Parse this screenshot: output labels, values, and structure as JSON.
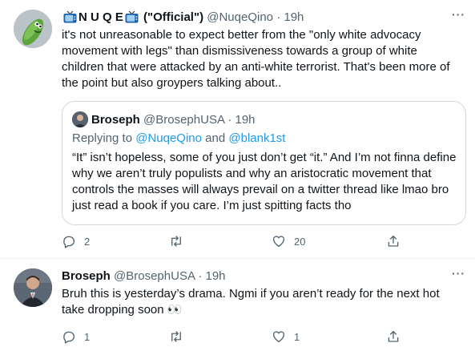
{
  "tweet1": {
    "display_name_prefix_icon": "tv-emoji-icon",
    "display_name": "N U Q E",
    "display_name_suffix_icon": "tv-emoji-icon",
    "display_name_tag": "(\"Official\")",
    "handle": "@NuqeQino",
    "separator": "·",
    "time": "19h",
    "text": "it's not unreasonable to expect better from the \"only white advocacy movement with legs\" than dismissiveness towards a group of white children that were attacked by an anti-white terrorist. That's been more of the point but also groypers talking about..",
    "quote": {
      "display_name": "Broseph",
      "handle": "@BrosephUSA",
      "separator": "·",
      "time": "19h",
      "replying_prefix": "Replying to",
      "replying_to_1": "@NuqeQino",
      "replying_and": "and",
      "replying_to_2": "@blank1st",
      "text": "“It” isn’t hopeless, some of you just don’t get “it.” And I’m not finna define why we aren’t truly populists and why an aristocratic movement that controls the masses will always prevail on a twitter thread like lmao bro just read a book if you care. I’m just spitting facts tho"
    },
    "actions": {
      "reply_count": "2",
      "retweet_count": "",
      "like_count": "20"
    }
  },
  "tweet2": {
    "display_name": "Broseph",
    "handle": "@BrosephUSA",
    "separator": "·",
    "time": "19h",
    "text": "Bruh this is yesterday’s drama. Ngmi if you aren’t ready for the next hot take dropping soon 👀",
    "actions": {
      "reply_count": "1",
      "retweet_count": "",
      "like_count": "1"
    }
  },
  "more_label": "···",
  "colors": {
    "text": "#0f1419",
    "muted": "#536471",
    "link": "#1d9bf0",
    "border": "#cfd9de",
    "divider": "#eff3f4"
  }
}
